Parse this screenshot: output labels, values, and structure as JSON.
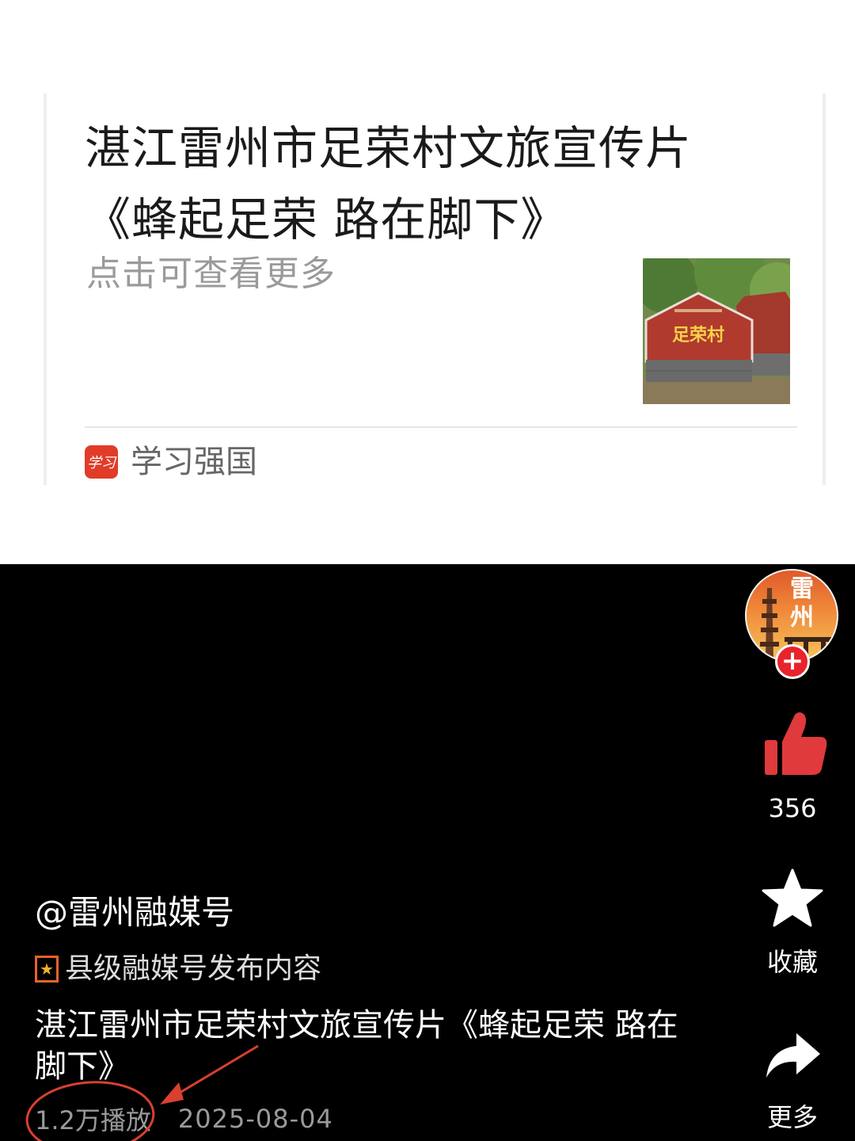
{
  "share_card": {
    "title_line1": "湛江雷州市足荣村文旅宣传片",
    "title_line2": "《蜂起足荣 路在脚下》",
    "subtitle": "点击可查看更多",
    "thumbnail_sign_text": "足荣村",
    "source_logo_text": "学习",
    "source_name": "学习强国"
  },
  "video": {
    "avatar_text": "雷州",
    "follow_symbol": "+",
    "like_count": "356",
    "favorite_label": "收藏",
    "more_label": "更多",
    "author": "@雷州融媒号",
    "badge_text": "县级融媒号发布内容",
    "description_line1": "湛江雷州市足荣村文旅宣传片《蜂起足荣 路在",
    "description_line2": "脚下》",
    "plays": "1.2万播放",
    "date": "2025-08-04"
  },
  "colors": {
    "like_red": "#e03a3c",
    "annotation_red": "#d8402f",
    "badge_orange": "#e8632b"
  },
  "icons": [
    "thumbs-up-icon",
    "star-icon",
    "share-arrow-icon",
    "verified-badge-icon",
    "plus-icon"
  ]
}
